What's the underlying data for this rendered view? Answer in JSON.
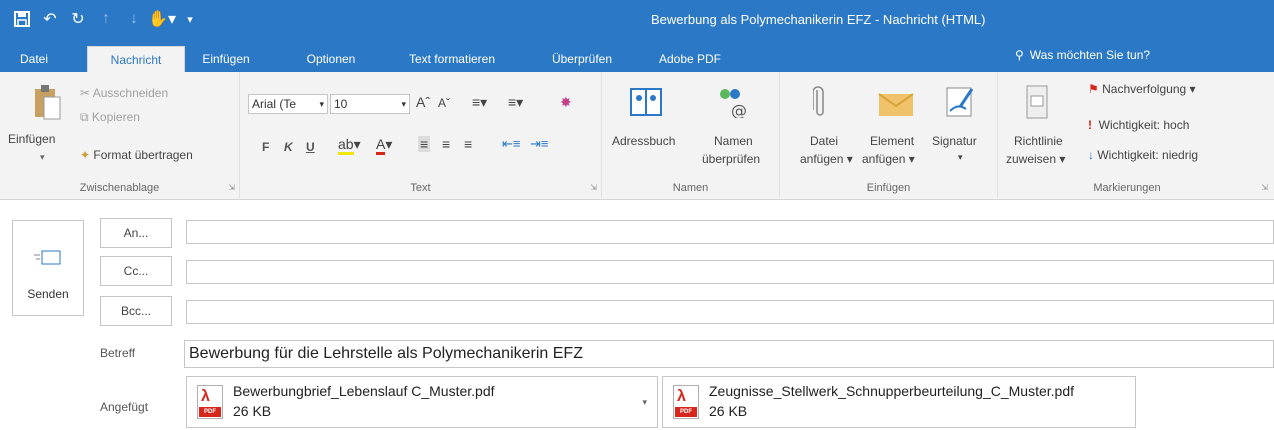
{
  "window": {
    "title": "Bewerbung als Polymechanikerin EFZ - Nachricht (HTML)"
  },
  "quick_access": {
    "icons": [
      "save-icon",
      "undo-icon",
      "redo-icon",
      "up-icon",
      "down-icon",
      "touch-mode-icon",
      "customize-icon"
    ]
  },
  "tabs": [
    {
      "label": "Datei"
    },
    {
      "label": "Nachricht"
    },
    {
      "label": "Einfügen"
    },
    {
      "label": "Optionen"
    },
    {
      "label": "Text formatieren"
    },
    {
      "label": "Überprüfen"
    },
    {
      "label": "Adobe PDF"
    }
  ],
  "tell_me": "Was möchten Sie tun?",
  "ribbon": {
    "clipboard": {
      "paste": "Einfügen",
      "cut": "Ausschneiden",
      "copy": "Kopieren",
      "format_painter": "Format übertragen",
      "group": "Zwischenablage"
    },
    "text": {
      "font": "Arial (Te",
      "size": "10",
      "bold": "F",
      "italic": "K",
      "underline": "U",
      "group": "Text"
    },
    "names": {
      "address_book": "Adressbuch",
      "check_names_1": "Namen",
      "check_names_2": "überprüfen",
      "group": "Namen"
    },
    "insert": {
      "attach_file_1": "Datei",
      "attach_file_2": "anfügen",
      "attach_item_1": "Element",
      "attach_item_2": "anfügen",
      "signature": "Signatur",
      "group": "Einfügen"
    },
    "tags": {
      "policy_1": "Richtlinie",
      "policy_2": "zuweisen",
      "follow_up": "Nachverfolgung",
      "high": "Wichtigkeit: hoch",
      "low": "Wichtigkeit: niedrig",
      "group": "Markierungen"
    }
  },
  "compose": {
    "send": "Senden",
    "to": "An...",
    "cc": "Cc...",
    "bcc": "Bcc...",
    "subject_label": "Betreff",
    "subject": "Bewerbung für die Lehrstelle als Polymechanikerin EFZ",
    "attached_label": "Angefügt",
    "attachments": [
      {
        "name": "Bewerbungbrief_Lebenslauf C_Muster.pdf",
        "size": "26 KB"
      },
      {
        "name": "Zeugnisse_Stellwerk_Schnupperbeurteilung_C_Muster.pdf",
        "size": "26 KB"
      }
    ]
  },
  "colors": {
    "accent": "#2b79c6",
    "ribbon_bg": "#f3f3f3",
    "pdf_red": "#d7261c"
  }
}
